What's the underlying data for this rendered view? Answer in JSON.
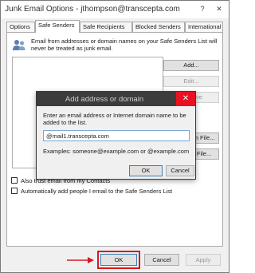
{
  "window": {
    "title": "Junk Email Options - jthompson@transcepta.com",
    "help_glyph": "?",
    "close_glyph": "✕"
  },
  "tabs": [
    {
      "label": "Options"
    },
    {
      "label": "Safe Senders"
    },
    {
      "label": "Safe Recipients"
    },
    {
      "label": "Blocked Senders"
    },
    {
      "label": "International"
    }
  ],
  "panel": {
    "info_text": "Email from addresses or domain names on your Safe Senders List will never be treated as junk email.",
    "icon": "people-icon",
    "buttons": {
      "add": "Add...",
      "edit": "Edit...",
      "remove": "Remove",
      "import": "Import from File...",
      "export": "Export to File..."
    },
    "checkboxes": [
      {
        "label": "Also trust email from my Contacts",
        "checked": false
      },
      {
        "label": "Automatically add people I email to the Safe Senders List",
        "checked": false
      }
    ]
  },
  "footer": {
    "ok": "OK",
    "cancel": "Cancel",
    "apply": "Apply"
  },
  "dialog": {
    "title": "Add address or domain",
    "close_glyph": "✕",
    "message": "Enter an email address or Internet domain name to be added to the list.",
    "input_value": "@mail1.transcepta.com",
    "examples": "Examples: someone@example.com or @example.com",
    "ok": "OK",
    "cancel": "Cancel"
  },
  "colors": {
    "highlight": "#d71920",
    "dialog_title_bg": "#3c3c3c",
    "close_red": "#e81123"
  }
}
